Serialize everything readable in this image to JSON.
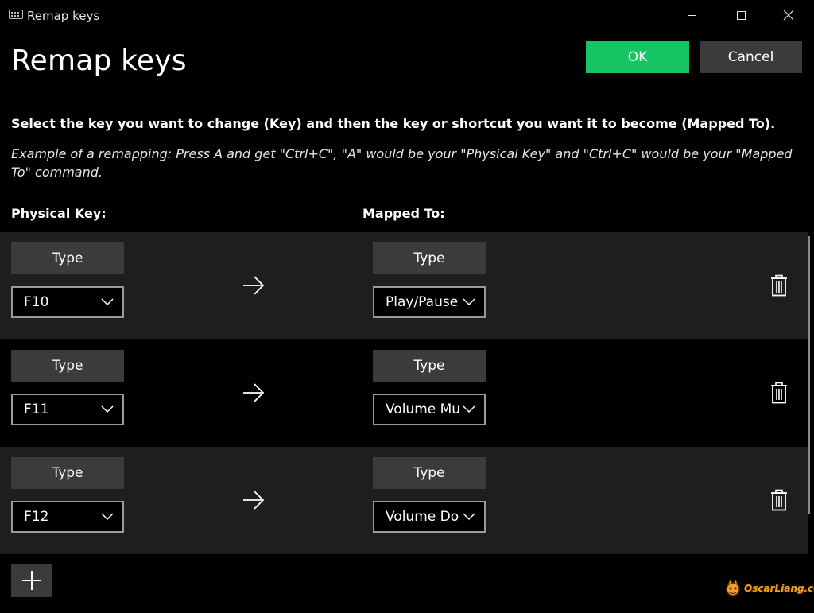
{
  "window": {
    "title": "Remap keys"
  },
  "header": {
    "page_title": "Remap keys",
    "ok_label": "OK",
    "cancel_label": "Cancel"
  },
  "instructions": {
    "primary": "Select the key you want to change (Key) and then the key or shortcut you want it to become (Mapped To).",
    "example": "Example of a remapping: Press A and get \"Ctrl+C\", \"A\" would be your \"Physical Key\" and \"Ctrl+C\" would be your \"Mapped To\" command."
  },
  "columns": {
    "physical_key": "Physical Key:",
    "mapped_to": "Mapped To:"
  },
  "rows": [
    {
      "type_label": "Type",
      "physical_key": "F10",
      "mapped_type_label": "Type",
      "mapped_to": "Play/Pause"
    },
    {
      "type_label": "Type",
      "physical_key": "F11",
      "mapped_type_label": "Type",
      "mapped_to": "Volume Mute"
    },
    {
      "type_label": "Type",
      "physical_key": "F12",
      "mapped_type_label": "Type",
      "mapped_to": "Volume Down"
    }
  ],
  "watermark": {
    "text": "OscarLiang.com"
  },
  "colors": {
    "ok_accent": "#16c464",
    "button_gray": "#3b3b3b",
    "row_shade": "#1e1e1e",
    "background": "#000000"
  },
  "icons": {
    "app": "keyboard-icon",
    "minimize": "minimize-icon",
    "maximize": "maximize-icon",
    "close": "close-icon",
    "arrow": "arrow-right-icon",
    "dropdown": "chevron-down-icon",
    "delete": "trash-icon",
    "add": "plus-icon"
  }
}
